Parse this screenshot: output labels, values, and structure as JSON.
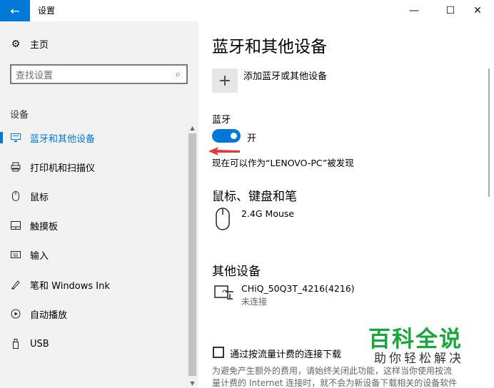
{
  "window": {
    "title": "设置",
    "minimize_glyph": "—",
    "maximize_glyph": "☐",
    "close_glyph": "✕",
    "back_glyph": "←"
  },
  "sidebar": {
    "home_label": "主页",
    "search_placeholder": "查找设置",
    "section": "设备",
    "items": [
      {
        "label": "蓝牙和其他设备",
        "icon": "bluetooth-devices-icon",
        "active": true
      },
      {
        "label": "打印机和扫描仪",
        "icon": "printer-icon",
        "active": false
      },
      {
        "label": "鼠标",
        "icon": "mouse-icon",
        "active": false
      },
      {
        "label": "触摸板",
        "icon": "touchpad-icon",
        "active": false
      },
      {
        "label": "输入",
        "icon": "keyboard-icon",
        "active": false
      },
      {
        "label": "笔和 Windows Ink",
        "icon": "pen-icon",
        "active": false
      },
      {
        "label": "自动播放",
        "icon": "autoplay-icon",
        "active": false
      },
      {
        "label": "USB",
        "icon": "usb-icon",
        "active": false
      }
    ]
  },
  "main": {
    "title": "蓝牙和其他设备",
    "add_device_label": "添加蓝牙或其他设备",
    "bluetooth_label": "蓝牙",
    "bluetooth_state": "开",
    "discoverable_text": "现在可以作为“LENOVO-PC”被发现",
    "mouse_section_title": "鼠标、键盘和笔",
    "mouse_device_name": "2.4G Mouse",
    "other_section_title": "其他设备",
    "other_device_name": "CHiQ_50Q3T_4216(4216)",
    "other_device_status": "未连接",
    "metered_checkbox_label": "通过按流量计费的连接下载",
    "metered_desc_line1": "为避免产生额外的费用，请始终关闭此功能，这样当你使用按流",
    "metered_desc_line2": "量计费的 Internet 连接时，就不会为新设备下载相关的设备软件"
  },
  "watermark": {
    "title": "百科全说",
    "subtitle": "助你轻松解决"
  },
  "colors": {
    "accent": "#0078d7",
    "sidebar_bg": "#f2f2f2",
    "annotation_arrow": "#e53935",
    "watermark_green": "#19a63d"
  }
}
